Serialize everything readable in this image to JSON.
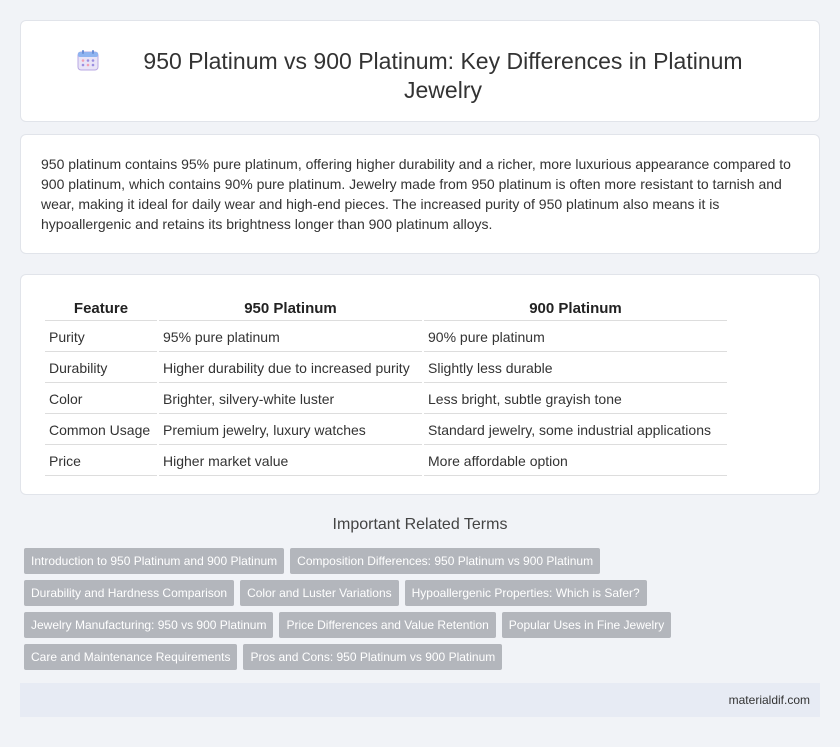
{
  "header": {
    "title": "950 Platinum vs 900 Platinum: Key Differences in Platinum Jewelry",
    "icon": "calendar-icon"
  },
  "summary": {
    "text": "950 platinum contains 95% pure platinum, offering higher durability and a richer, more luxurious appearance compared to 900 platinum, which contains 90% pure platinum. Jewelry made from 950 platinum is often more resistant to tarnish and wear, making it ideal for daily wear and high-end pieces. The increased purity of 950 platinum also means it is hypoallergenic and retains its brightness longer than 900 platinum alloys."
  },
  "table": {
    "headers": [
      "Feature",
      "950 Platinum",
      "900 Platinum"
    ],
    "rows": [
      [
        "Purity",
        "95% pure platinum",
        "90% pure platinum"
      ],
      [
        "Durability",
        "Higher durability due to increased purity",
        "Slightly less durable"
      ],
      [
        "Color",
        "Brighter, silvery-white luster",
        "Less bright, subtle grayish tone"
      ],
      [
        "Common Usage",
        "Premium jewelry, luxury watches",
        "Standard jewelry, some industrial applications"
      ],
      [
        "Price",
        "Higher market value",
        "More affordable option"
      ]
    ]
  },
  "related": {
    "title": "Important Related Terms",
    "rows": [
      [
        "Introduction to 950 Platinum and 900 Platinum",
        "Composition Differences: 950 Platinum vs 900 Platinum"
      ],
      [
        "Durability and Hardness Comparison",
        "Color and Luster Variations",
        "Hypoallergenic Properties: Which is Safer?"
      ],
      [
        "Jewelry Manufacturing: 950 vs 900 Platinum",
        "Price Differences and Value Retention",
        "Popular Uses in Fine Jewelry"
      ],
      [
        "Care and Maintenance Requirements",
        "Pros and Cons: 950 Platinum vs 900 Platinum"
      ]
    ]
  },
  "footer": {
    "site": "materialdif.com"
  },
  "colors": {
    "tag_bg": "#b3b6bc",
    "footer_bg": "#e7ebf4",
    "page_bg": "#f1f3f7"
  }
}
